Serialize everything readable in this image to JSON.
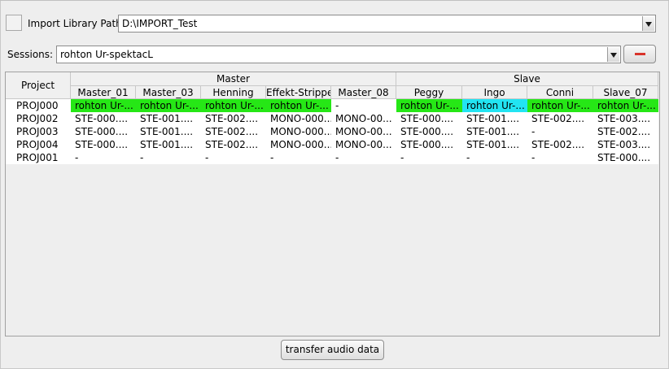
{
  "import": {
    "label": "Import Library Path:",
    "path": "D:\\IMPORT_Test"
  },
  "sessions": {
    "label": "Sessions:",
    "selected": "rohton Ur-spektacL"
  },
  "table": {
    "project_header": "Project",
    "groups": [
      {
        "label": "Master"
      },
      {
        "label": "Slave"
      }
    ],
    "columns": [
      "Master_01",
      "Master_03",
      "Henning",
      "Effekt-Strippe",
      "Master_08",
      "Peggy",
      "Ingo",
      "Conni",
      "Slave_07"
    ],
    "rows": [
      {
        "project": "PROJ000",
        "cells": [
          "rohton Ur-...",
          "rohton Ur-...",
          "rohton Ur-...",
          "rohton Ur-...",
          "-",
          "rohton Ur-...",
          "rohton Ur-...",
          "rohton Ur-...",
          "rohton Ur-..."
        ],
        "colors": [
          "#26e716",
          "#26e716",
          "#26e716",
          "#26e716",
          "",
          "#26e716",
          "#22e4f2",
          "#26e716",
          "#26e716"
        ]
      },
      {
        "project": "PROJ002",
        "cells": [
          "STE-000....",
          "STE-001....",
          "STE-002....",
          "MONO-000...",
          "MONO-00...",
          "STE-000....",
          "STE-001....",
          "STE-002....",
          "STE-003...."
        ],
        "colors": [
          "",
          "",
          "",
          "",
          "",
          "",
          "",
          "",
          ""
        ]
      },
      {
        "project": "PROJ003",
        "cells": [
          "STE-000....",
          "STE-001....",
          "STE-002....",
          "MONO-000...",
          "MONO-00...",
          "STE-000....",
          "STE-001....",
          "-",
          "STE-002...."
        ],
        "colors": [
          "",
          "",
          "",
          "",
          "",
          "",
          "",
          "",
          ""
        ]
      },
      {
        "project": "PROJ004",
        "cells": [
          "STE-000....",
          "STE-001....",
          "STE-002....",
          "MONO-000...",
          "MONO-00...",
          "STE-000....",
          "STE-001....",
          "STE-002....",
          "STE-003...."
        ],
        "colors": [
          "",
          "",
          "",
          "",
          "",
          "",
          "",
          "",
          ""
        ]
      },
      {
        "project": "PROJ001",
        "cells": [
          "-",
          "-",
          "-",
          "-",
          "-",
          "-",
          "-",
          "-",
          "STE-000...."
        ],
        "colors": [
          "",
          "",
          "",
          "",
          "",
          "",
          "",
          "",
          ""
        ]
      }
    ]
  },
  "transfer": {
    "label": "transfer audio data"
  }
}
